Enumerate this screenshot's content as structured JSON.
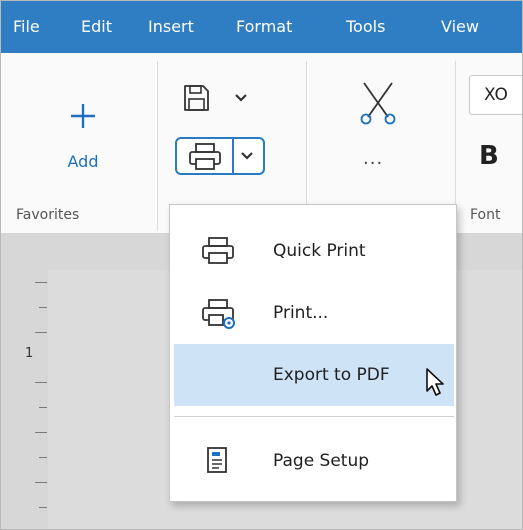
{
  "menubar": {
    "items": [
      "File",
      "Edit",
      "Insert",
      "Format",
      "Tools",
      "View"
    ]
  },
  "ribbon": {
    "add_label": "Add",
    "groups": {
      "favorites": "Favorites",
      "font": "Font"
    },
    "font_name": "XO",
    "bold_label": "B",
    "more_label": "···",
    "icons": [
      "plus-icon",
      "floppy-disk-icon",
      "printer-icon",
      "scissors-icon",
      "chevron-down-icon"
    ]
  },
  "dropdown": {
    "items": [
      {
        "label": "Quick Print",
        "icon": "printer-icon"
      },
      {
        "label": "Print...",
        "icon": "printer-settings-icon"
      },
      {
        "label": "Export to PDF",
        "icon": ""
      },
      {
        "label": "Page Setup",
        "icon": "page-setup-icon"
      }
    ]
  },
  "ruler": {
    "number_label": "1"
  },
  "colors": {
    "menubar_bg": "#2f7dc3",
    "accent": "#1e6fbf",
    "highlight": "#cfe3f6"
  }
}
